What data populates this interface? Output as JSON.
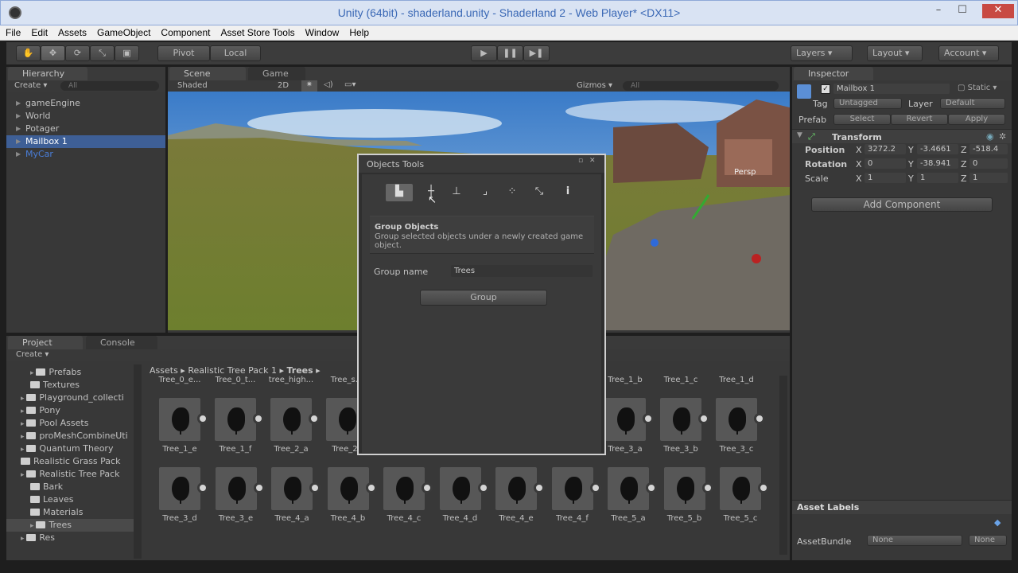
{
  "window": {
    "title": "Unity (64bit) - shaderland.unity - Shaderland 2 - Web Player* <DX11>",
    "minimize": "–",
    "maximize": "☐",
    "close": "✕"
  },
  "menu": [
    "File",
    "Edit",
    "Assets",
    "GameObject",
    "Component",
    "Asset Store Tools",
    "Window",
    "Help"
  ],
  "toolbar": {
    "pivot": "Pivot",
    "local": "Local",
    "layers": "Layers",
    "layout": "Layout",
    "account": "Account"
  },
  "hierarchy": {
    "tab": "Hierarchy",
    "create": "Create",
    "search": "All",
    "items": [
      {
        "label": "gameEngine",
        "selected": false,
        "prefab": false
      },
      {
        "label": "World",
        "selected": false,
        "prefab": false
      },
      {
        "label": "Potager",
        "selected": false,
        "prefab": false
      },
      {
        "label": "Mailbox 1",
        "selected": true,
        "prefab": false
      },
      {
        "label": "MyCar",
        "selected": false,
        "prefab": true
      }
    ]
  },
  "scene": {
    "tab_scene": "Scene",
    "tab_game": "Game",
    "shading": "Shaded",
    "mode_2d": "2D",
    "gizmos": "Gizmos",
    "search": "All",
    "persp": "Persp"
  },
  "objects_tools": {
    "title": "Objects Tools",
    "heading": "Group Objects",
    "description": "Group selected objects under a newly created game object.",
    "group_name_label": "Group name",
    "group_name_value": "Trees",
    "group_button": "Group"
  },
  "project": {
    "tab_project": "Project",
    "tab_console": "Console",
    "create": "Create",
    "folders": [
      "Prefabs",
      "Textures",
      "Playground_collecti",
      "Pony",
      "Pool Assets",
      "proMeshCombineUti",
      "Quantum Theory",
      "Realistic Grass Pack",
      "Realistic Tree Pack",
      "Bark",
      "Leaves",
      "Materials",
      "Trees",
      "Res"
    ],
    "breadcrumb": [
      "Assets",
      "Realistic Tree Pack 1",
      "Trees"
    ],
    "top_row_labels": [
      "Tree_0_e...",
      "Tree_0_t...",
      "tree_high...",
      "Tree_s...",
      "Tree_1_b",
      "Tree_1_c",
      "Tree_1_d"
    ],
    "row1": [
      "Tree_1_e",
      "Tree_1_f",
      "Tree_2_a",
      "Tree_2_",
      "Tree_3_a",
      "Tree_3_b",
      "Tree_3_c"
    ],
    "row2": [
      "Tree_3_d",
      "Tree_3_e",
      "Tree_4_a",
      "Tree_4_b",
      "Tree_4_c",
      "Tree_4_d",
      "Tree_4_e",
      "Tree_4_f",
      "Tree_5_a",
      "Tree_5_b",
      "Tree_5_c"
    ]
  },
  "inspector": {
    "tab": "Inspector",
    "object_name": "Mailbox 1",
    "static": "Static",
    "tag_label": "Tag",
    "tag_value": "Untagged",
    "layer_label": "Layer",
    "layer_value": "Default",
    "prefab_label": "Prefab",
    "select": "Select",
    "revert": "Revert",
    "apply": "Apply",
    "transform": "Transform",
    "position_label": "Position",
    "pos_x": "3272.2",
    "pos_y": "-3.4661",
    "pos_z": "-518.4",
    "rotation_label": "Rotation",
    "rot_x": "0",
    "rot_y": "-38.941",
    "rot_z": "0",
    "scale_label": "Scale",
    "scl_x": "1",
    "scl_y": "1",
    "scl_z": "1",
    "add_component": "Add Component",
    "asset_labels": "Asset Labels",
    "assetbundle_label": "AssetBundle",
    "assetbundle_value": "None",
    "variant_value": "None"
  }
}
